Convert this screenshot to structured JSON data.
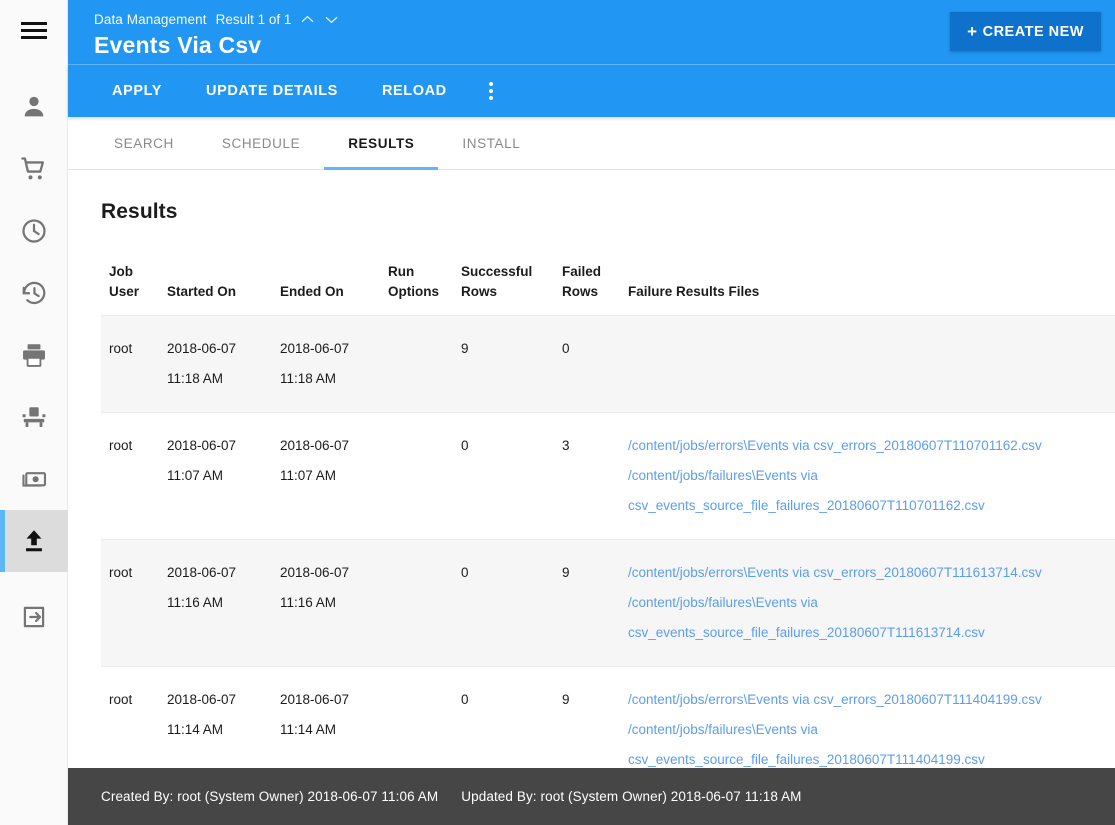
{
  "rail": {
    "menu_label": "menu",
    "items": [
      {
        "name": "person",
        "icon": "person-icon",
        "active": false
      },
      {
        "name": "cart",
        "icon": "shopping-cart-icon",
        "active": false
      },
      {
        "name": "clock",
        "icon": "clock-icon",
        "active": false
      },
      {
        "name": "history",
        "icon": "history-icon",
        "active": false
      },
      {
        "name": "print",
        "icon": "print-icon",
        "active": false
      },
      {
        "name": "device",
        "icon": "device-icon",
        "active": false
      },
      {
        "name": "payment",
        "icon": "payment-icon",
        "active": false
      },
      {
        "name": "upload",
        "icon": "upload-icon",
        "active": true
      },
      {
        "name": "logout",
        "icon": "logout-icon",
        "active": false
      }
    ]
  },
  "header": {
    "breadcrumb": "Data Management",
    "result_count": "Result 1 of 1",
    "title": "Events Via Csv",
    "create_new_label": "CREATE NEW",
    "create_new_plus": "+"
  },
  "actions": {
    "items": [
      {
        "label": "APPLY"
      },
      {
        "label": "UPDATE DETAILS"
      },
      {
        "label": "RELOAD"
      }
    ],
    "overflow_label": "more options"
  },
  "tabs": [
    {
      "label": "SEARCH",
      "selected": false
    },
    {
      "label": "SCHEDULE",
      "selected": false
    },
    {
      "label": "RESULTS",
      "selected": true
    },
    {
      "label": "INSTALL",
      "selected": false
    }
  ],
  "results": {
    "title": "Results",
    "columns": [
      "Job User",
      "Started On",
      "Ended On",
      "Run Options",
      "Successful Rows",
      "Failed Rows",
      "Failure Results Files"
    ],
    "column_lines": [
      [
        "Job",
        "User"
      ],
      [
        "",
        "Started On"
      ],
      [
        "",
        "Ended On"
      ],
      [
        "Run",
        "Options"
      ],
      [
        "Successful",
        "Rows"
      ],
      [
        "Failed",
        "Rows"
      ],
      [
        "",
        "Failure Results Files"
      ]
    ],
    "rows": [
      {
        "job_user": "root",
        "started_date": "2018-06-07",
        "started_time": "11:18 AM",
        "ended_date": "2018-06-07",
        "ended_time": "11:18 AM",
        "run_options": "",
        "successful_rows": "9",
        "failed_rows": "0",
        "failure_files": []
      },
      {
        "job_user": "root",
        "started_date": "2018-06-07",
        "started_time": "11:07 AM",
        "ended_date": "2018-06-07",
        "ended_time": "11:07 AM",
        "run_options": "",
        "successful_rows": "0",
        "failed_rows": "3",
        "failure_files": [
          "/content/jobs/errors\\Events via csv_errors_20180607T110701162.csv",
          "/content/jobs/failures\\Events via csv_events_source_file_failures_20180607T110701162.csv"
        ]
      },
      {
        "job_user": "root",
        "started_date": "2018-06-07",
        "started_time": "11:16 AM",
        "ended_date": "2018-06-07",
        "ended_time": "11:16 AM",
        "run_options": "",
        "successful_rows": "0",
        "failed_rows": "9",
        "failure_files": [
          "/content/jobs/errors\\Events via csv_errors_20180607T111613714.csv",
          "/content/jobs/failures\\Events via csv_events_source_file_failures_20180607T111613714.csv"
        ]
      },
      {
        "job_user": "root",
        "started_date": "2018-06-07",
        "started_time": "11:14 AM",
        "ended_date": "2018-06-07",
        "ended_time": "11:14 AM",
        "run_options": "",
        "successful_rows": "0",
        "failed_rows": "9",
        "failure_files": [
          "/content/jobs/errors\\Events via csv_errors_20180607T111404199.csv",
          "/content/jobs/failures\\Events via csv_events_source_file_failures_20180607T111404199.csv"
        ]
      }
    ]
  },
  "footer": {
    "created_by": "Created By: root (System Owner) 2018-06-07 11:06 AM",
    "updated_by": "Updated By: root (System Owner) 2018-06-07 11:18 AM"
  },
  "colors": {
    "primary": "#2196f3",
    "primary_dark": "#0e72cc",
    "tab_indicator": "#64b5f6",
    "link": "#5c9ded",
    "footer_bg": "#464646",
    "row_shade": "#f6f6f6",
    "rail_bg": "#fafafa",
    "rail_active_bg": "#dcdcdc",
    "rail_active_accent": "#5bb8f5"
  }
}
